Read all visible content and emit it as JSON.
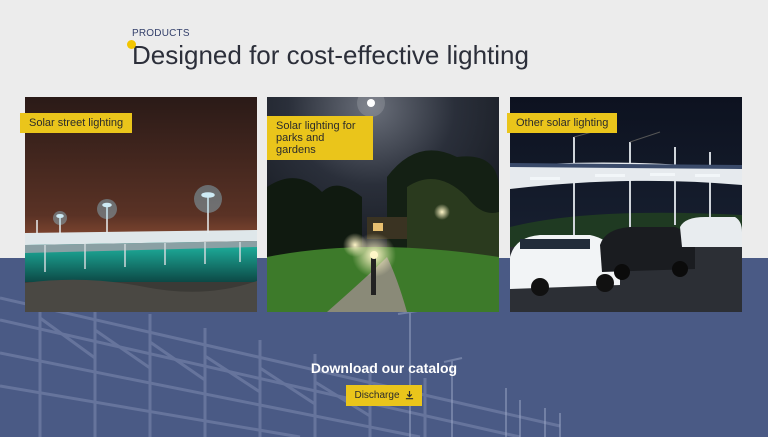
{
  "section": {
    "eyebrow": "PRODUCTS",
    "title": "Designed for cost-effective lighting"
  },
  "cards": [
    {
      "label": "Solar street lighting",
      "image": "pier-with-street-lamps-at-night"
    },
    {
      "label": "Solar lighting for parks and gardens",
      "image": "garden-path-with-lamps-at-night"
    },
    {
      "label": "Other solar lighting",
      "image": "solar-carport-with-cars-at-night"
    }
  ],
  "catalog": {
    "title": "Download our catalog",
    "button_label": "Discharge",
    "button_icon": "download-icon"
  },
  "colors": {
    "accent": "#eac51b",
    "band": "#4a5a85",
    "background": "#ececec",
    "title_text": "#2c2f3a"
  }
}
